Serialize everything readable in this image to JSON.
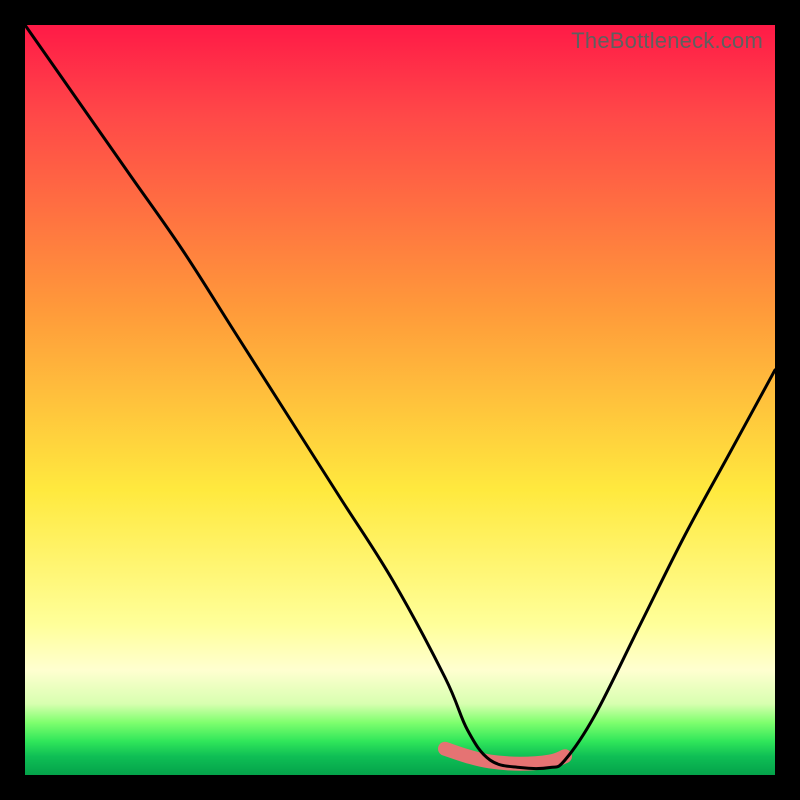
{
  "watermark": "TheBottleneck.com",
  "colors": {
    "black": "#000000",
    "curve": "#000000",
    "highlight": "#e57373",
    "red_top": "#ff1a47",
    "red_mid": "#ff4848",
    "orange": "#ff9a3a",
    "yellow": "#ffe93e",
    "pale_yellow": "#ffff9a",
    "faint_yellow": "#ffffd0",
    "green_light": "#7fff6e",
    "green_mid": "#30e65a",
    "green_dark": "#0fbf55",
    "green_deep": "#04a24a"
  },
  "chart_data": {
    "type": "line",
    "title": "",
    "xlabel": "",
    "ylabel": "",
    "xlim": [
      0,
      100
    ],
    "ylim": [
      0,
      100
    ],
    "series": [
      {
        "name": "bottleneck-curve",
        "x": [
          0,
          7,
          14,
          21,
          28,
          35,
          42,
          49,
          56,
          59,
          62,
          66,
          70,
          72,
          76,
          82,
          88,
          94,
          100
        ],
        "values": [
          100,
          90,
          80,
          70,
          59,
          48,
          37,
          26,
          13,
          6,
          2,
          1,
          1,
          2,
          8,
          20,
          32,
          43,
          54
        ]
      },
      {
        "name": "optimal-range-highlight",
        "x": [
          56,
          59,
          62,
          66,
          70,
          72
        ],
        "values": [
          3.5,
          2.5,
          1.8,
          1.5,
          1.8,
          2.5
        ]
      }
    ],
    "background_gradient_stops": [
      {
        "pos": 0.0,
        "color": "#ff1a47"
      },
      {
        "pos": 0.12,
        "color": "#ff4848"
      },
      {
        "pos": 0.38,
        "color": "#ff9a3a"
      },
      {
        "pos": 0.62,
        "color": "#ffe93e"
      },
      {
        "pos": 0.8,
        "color": "#ffff9a"
      },
      {
        "pos": 0.86,
        "color": "#ffffd0"
      },
      {
        "pos": 0.905,
        "color": "#d8ffb0"
      },
      {
        "pos": 0.93,
        "color": "#7fff6e"
      },
      {
        "pos": 0.955,
        "color": "#30e65a"
      },
      {
        "pos": 0.975,
        "color": "#0fbf55"
      },
      {
        "pos": 1.0,
        "color": "#04a24a"
      }
    ]
  }
}
